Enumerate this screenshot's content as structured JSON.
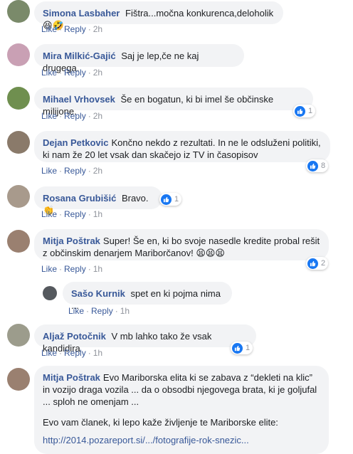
{
  "comments": [
    {
      "author": "Simona Lasbaher",
      "text": "Fištra...močna konkurenca,deloholik",
      "emoji": "😆🤣",
      "like": "Like",
      "reply": "Reply",
      "time": "2h"
    },
    {
      "author": "Mira Milkić-Gajić",
      "text": "Saj je lep,če ne kaj drugega.",
      "like": "Like",
      "reply": "Reply",
      "time": "2h"
    },
    {
      "author": "Mihael Vrhovsek",
      "text": "Še en bogatun, ki bi imel še občinske milijone.",
      "like": "Like",
      "reply": "Reply",
      "time": "2h",
      "reactions": "1"
    },
    {
      "author": "Dejan Petkovic",
      "text1": "Končno nekdo z rezultati. In ne le odsluženi politiki,",
      "text2": "ki nam že 20 let vsak dan skačejo iz TV in časopisov",
      "like": "Like",
      "reply": "Reply",
      "time": "2h",
      "reactions": "8"
    },
    {
      "author": "Rosana Grubišić",
      "text": "Bravo.",
      "emoji": "👏",
      "like": "Like",
      "reply": "Reply",
      "time": "1h",
      "reactions": "1"
    },
    {
      "author": "Mitja Poštrak",
      "text1": "Super! Še en, ki bo svoje nasedle kredite probal rešit",
      "text2": "z občinskim denarjem Mariborčanov!",
      "emoji": "😫😫😫",
      "like": "Like",
      "reply": "Reply",
      "time": "1h",
      "reactions": "2"
    },
    {
      "author": "Sašo Kurnik",
      "text": "spet en ki pojma nima ...",
      "like": "Like",
      "reply": "Reply",
      "time": "1h"
    },
    {
      "author": "Aljaž Potočnik",
      "text": "V mb lahko tako že vsak kandidira",
      "like": "Like",
      "reply": "Reply",
      "time": "1h",
      "reactions": "1"
    },
    {
      "author": "Mitja Poštrak",
      "text1": "Evo Mariborska elita ki se zabava z “dekleti na klic”",
      "text2": "in vozijo draga vozila ... da o obsodbi njegovega brata, ki je goljufal",
      "text3": "... sploh ne omenjam ...",
      "text4": "Evo vam članek, ki lepo kaže življenje te Mariborske elite:",
      "link": "http://2014.pozareport.si/.../fotografije-rok-snezic..."
    }
  ],
  "colors": {
    "author": "#385898",
    "bubble": "#f2f3f5",
    "like_blue": "#1877f2"
  }
}
